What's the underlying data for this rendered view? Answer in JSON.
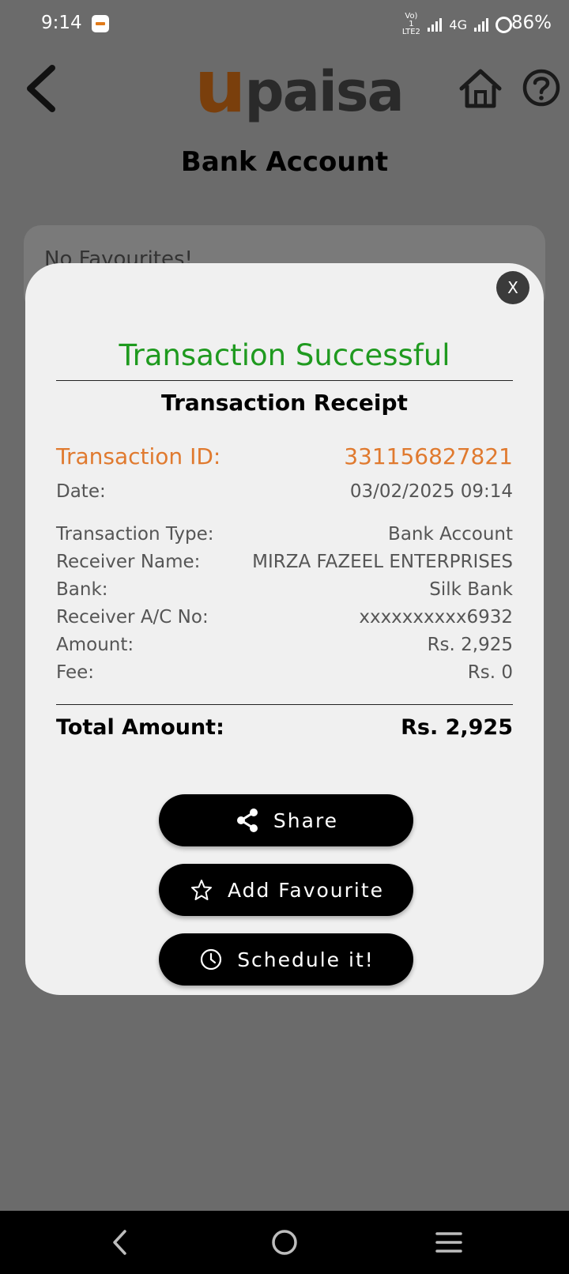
{
  "status_bar": {
    "time": "9:14",
    "volte": "Vo) 1 LTE2",
    "network": "4G",
    "battery": "86%"
  },
  "header": {
    "logo_u": "u",
    "logo_rest": "paisa",
    "title": "Bank Account"
  },
  "background_card": {
    "text": "No Favourites!"
  },
  "modal": {
    "close_label": "X",
    "success_title": "Transaction Successful",
    "receipt_title": "Transaction Receipt",
    "transaction_id": {
      "label": "Transaction ID:",
      "value": "331156827821"
    },
    "date": {
      "label": "Date:",
      "value": "03/02/2025 09:14"
    },
    "details": [
      {
        "label": "Transaction Type:",
        "value": "Bank Account"
      },
      {
        "label": "Receiver Name:",
        "value": "MIRZA FAZEEL ENTERPRISES"
      },
      {
        "label": "Bank:",
        "value": "Silk Bank"
      },
      {
        "label": "Receiver A/C No:",
        "value": "xxxxxxxxxx6932"
      },
      {
        "label": "Amount:",
        "value": "Rs. 2,925"
      },
      {
        "label": "Fee:",
        "value": "Rs. 0"
      }
    ],
    "total": {
      "label": "Total Amount:",
      "value": "Rs. 2,925"
    },
    "buttons": {
      "share": "Share",
      "favourite": "Add Favourite",
      "schedule": "Schedule it!"
    }
  },
  "icons": {
    "back": "back-arrow-icon",
    "home": "home-icon",
    "help": "help-icon",
    "share": "share-icon",
    "star": "star-icon",
    "clock": "clock-icon"
  },
  "colors": {
    "success": "#1f9a1f",
    "accent": "#e07a2f",
    "overlay_bg": "#6b6b6b",
    "modal_bg": "#f0f0f0"
  }
}
